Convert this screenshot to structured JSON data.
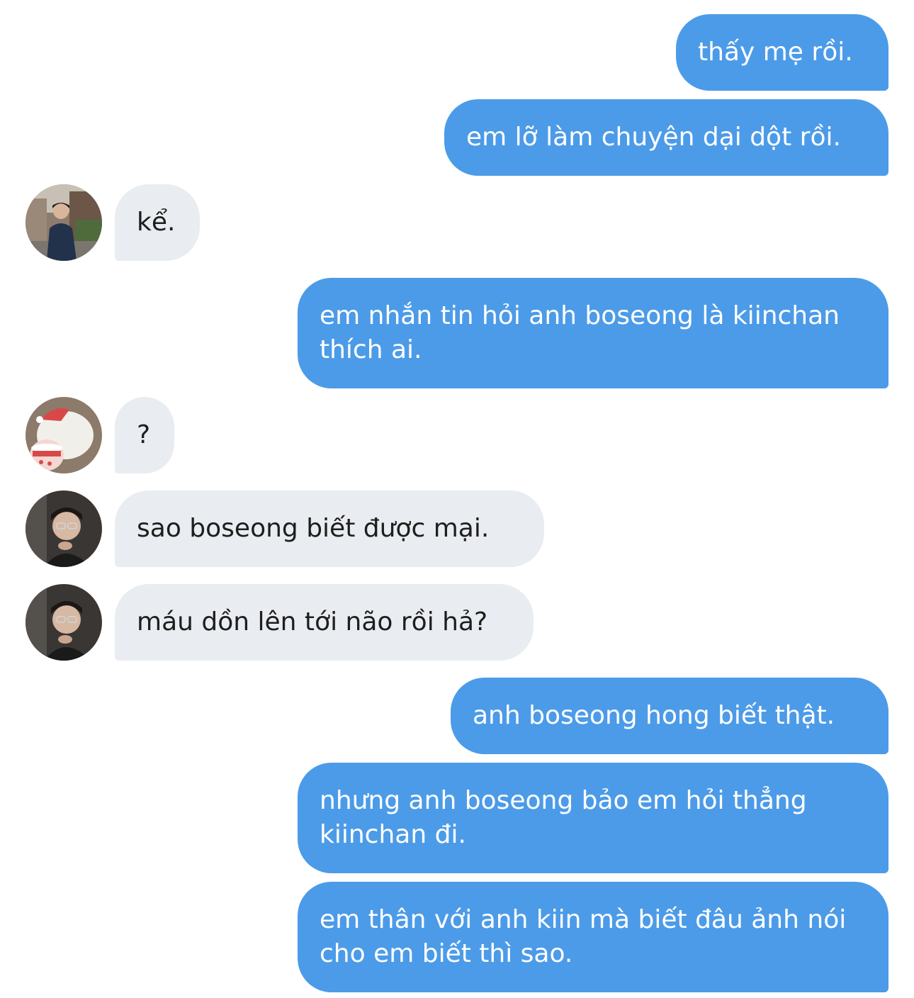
{
  "chat": {
    "messages": [
      {
        "side": "sent",
        "text": "thấy mẹ rồi."
      },
      {
        "side": "sent",
        "text": "em lỡ làm chuyện dại dột rồi."
      },
      {
        "side": "received",
        "sender_avatar": "avatar-photo-street",
        "text": "kể."
      },
      {
        "side": "sent",
        "text": "em nhắn tin hỏi anh boseong là kiinchan thích ai."
      },
      {
        "side": "received",
        "sender_avatar": "avatar-cartoon-bear",
        "text": "?"
      },
      {
        "side": "received",
        "sender_avatar": "avatar-photo-glasses",
        "text": "sao boseong biết được mại."
      },
      {
        "side": "received",
        "sender_avatar": "avatar-photo-glasses",
        "text": "máu dồn lên tới não rồi hả?"
      },
      {
        "side": "sent",
        "text": "anh boseong hong biết thật."
      },
      {
        "side": "sent",
        "text": "nhưng anh boseong bảo em hỏi thẳng kiinchan đi."
      },
      {
        "side": "sent",
        "text": "em thân với anh kiin mà biết đâu ảnh nói cho em biết thì sao."
      }
    ]
  },
  "colors": {
    "sent_bubble": "#4c9be8",
    "sent_text": "#ffffff",
    "received_bubble": "#e9ecf0",
    "received_text": "#1e1e1e",
    "background": "#ffffff"
  }
}
